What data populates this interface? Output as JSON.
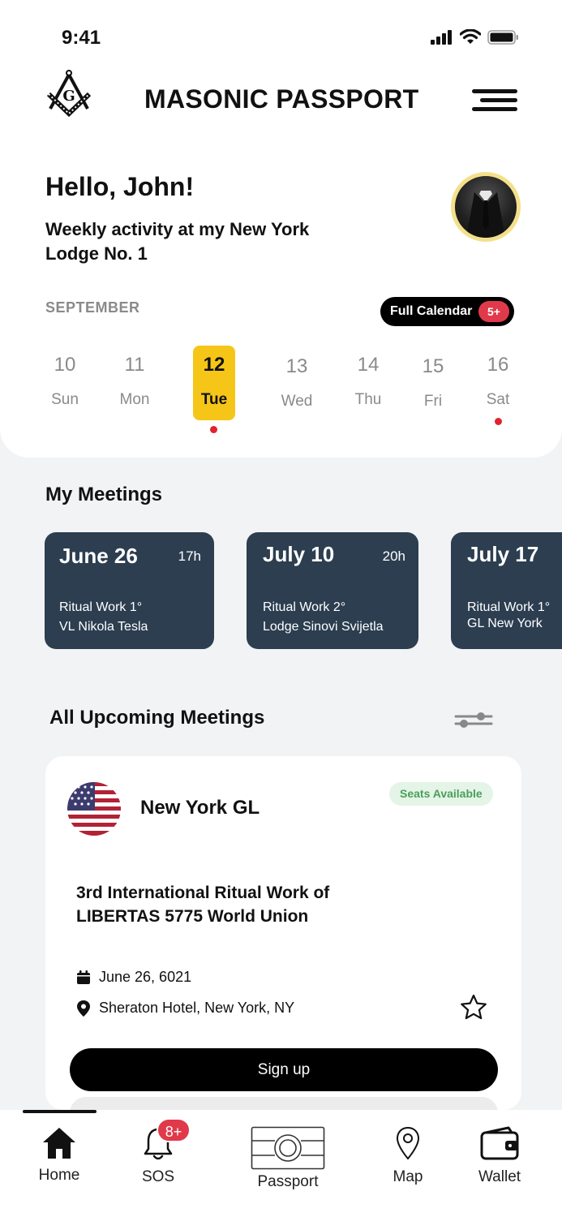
{
  "status_bar": {
    "time": "9:41"
  },
  "header": {
    "title": "MASONIC PASSPORT",
    "logo_letter": "G"
  },
  "greeting": {
    "hello": "Hello, John!",
    "subtitle": "Weekly activity at my New York Lodge No. 1"
  },
  "calendar": {
    "month": "SEPTEMBER",
    "full_calendar_label": "Full Calendar",
    "full_calendar_badge": "5+",
    "days": [
      {
        "num": "10",
        "dow": "Sun",
        "selected": false,
        "has_event": false
      },
      {
        "num": "11",
        "dow": "Mon",
        "selected": false,
        "has_event": false
      },
      {
        "num": "12",
        "dow": "Tue",
        "selected": true,
        "has_event": true
      },
      {
        "num": "13",
        "dow": "Wed",
        "selected": false,
        "has_event": false
      },
      {
        "num": "14",
        "dow": "Thu",
        "selected": false,
        "has_event": false
      },
      {
        "num": "15",
        "dow": "Fri",
        "selected": false,
        "has_event": false
      },
      {
        "num": "16",
        "dow": "Sat",
        "selected": false,
        "has_event": true
      }
    ]
  },
  "my_meetings": {
    "title": "My Meetings",
    "items": [
      {
        "date": "June 26",
        "time": "17h",
        "type": "Ritual Work 1°",
        "lodge": "VL Nikola Tesla"
      },
      {
        "date": "July 10",
        "time": "20h",
        "type": "Ritual Work 2°",
        "lodge": "Lodge Sinovi Svijetla"
      },
      {
        "date": "July 17",
        "time": "",
        "type": "Ritual Work 1°",
        "lodge": "GL New York"
      }
    ]
  },
  "upcoming": {
    "title": "All Upcoming Meetings",
    "event": {
      "organizer": "New York GL",
      "seats_label": "Seats Available",
      "title": "3rd International Ritual Work of LIBERTAS 5775 World Union",
      "date": "June 26, 6021",
      "location": "Sheraton Hotel, New York, NY",
      "signup_label": "Sign up"
    }
  },
  "tabbar": {
    "items": [
      {
        "label": "Home",
        "icon": "home-icon"
      },
      {
        "label": "SOS",
        "icon": "bell-icon",
        "badge": "8+"
      },
      {
        "label": "Passport",
        "icon": "passport-icon"
      },
      {
        "label": "Map",
        "icon": "map-pin-icon"
      },
      {
        "label": "Wallet",
        "icon": "wallet-icon"
      }
    ]
  },
  "colors": {
    "accent_yellow": "#f5c518",
    "meeting_card": "#2c3e50",
    "badge_red": "#e03a4a",
    "event_dot": "#e0242f",
    "seats_green": "#4a9f5a"
  }
}
